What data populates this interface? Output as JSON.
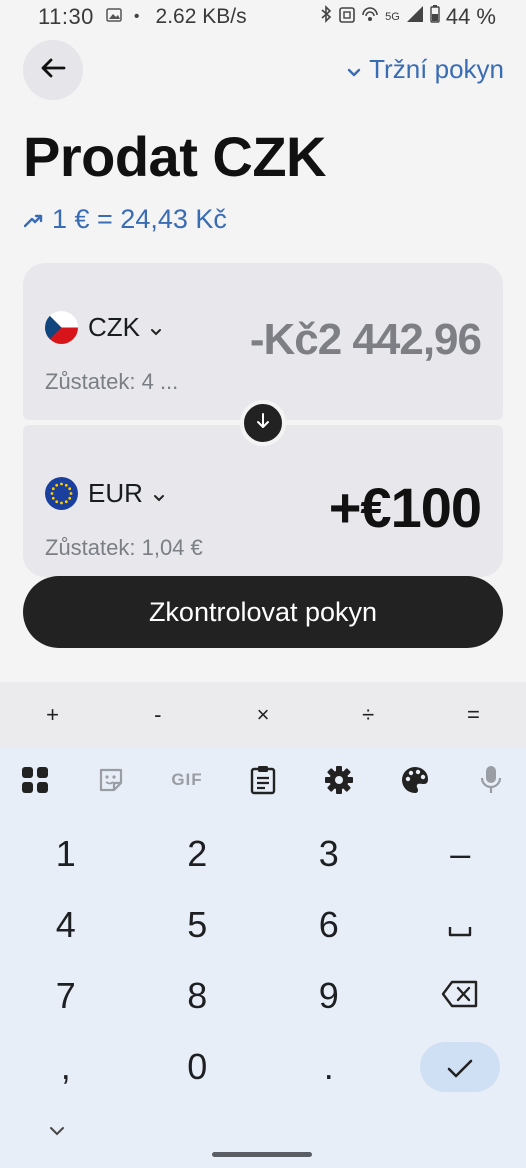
{
  "status_bar": {
    "time": "11:30",
    "net_speed": "2.62 KB/s",
    "network": "5G",
    "battery": "44 %"
  },
  "header": {
    "order_type": "Tržní pokyn",
    "title": "Prodat CZK",
    "rate": "1 € = 24,43 Kč"
  },
  "from": {
    "currency": "CZK",
    "balance": "Zůstatek: 4 ...",
    "amount": "-Kč2 442,96"
  },
  "to": {
    "currency": "EUR",
    "balance": "Zůstatek: 1,04 €",
    "amount": "+€100"
  },
  "cta_label": "Zkontrolovat pokyn",
  "keyboard": {
    "ops": [
      "+",
      "-",
      "×",
      "÷",
      "="
    ],
    "rows": [
      [
        "1",
        "2",
        "3",
        "–"
      ],
      [
        "4",
        "5",
        "6",
        "␣"
      ],
      [
        "7",
        "8",
        "9"
      ],
      [
        ",",
        "0",
        "."
      ]
    ]
  },
  "colors": {
    "accent": "#3a6cb4",
    "cta_bg": "#222222",
    "card_bg": "#e8e8ec"
  }
}
